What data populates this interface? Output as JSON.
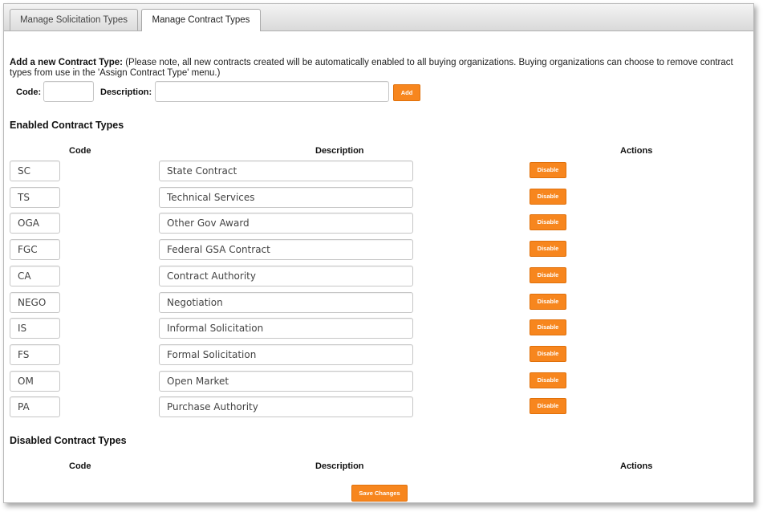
{
  "tabs": [
    {
      "label": "Manage Solicitation Types",
      "active": false
    },
    {
      "label": "Manage Contract Types",
      "active": true
    }
  ],
  "add_form": {
    "heading": "Add a new Contract Type:",
    "note": "(Please note, all new contracts created will be automatically enabled to all buying organizations. Buying organizations can choose to remove contract types from use in the 'Assign Contract Type' menu.)",
    "code_label": "Code:",
    "code_value": "",
    "description_label": "Description:",
    "description_value": "",
    "add_label": "Add"
  },
  "enabled": {
    "title": "Enabled Contract Types",
    "columns": {
      "code": "Code",
      "description": "Description",
      "actions": "Actions"
    },
    "action_label": "Disable",
    "rows": [
      {
        "code": "SC",
        "description": "State Contract"
      },
      {
        "code": "TS",
        "description": "Technical Services"
      },
      {
        "code": "OGA",
        "description": "Other Gov Award"
      },
      {
        "code": "FGC",
        "description": "Federal GSA Contract"
      },
      {
        "code": "CA",
        "description": "Contract Authority"
      },
      {
        "code": "NEGO",
        "description": "Negotiation"
      },
      {
        "code": "IS",
        "description": "Informal Solicitation"
      },
      {
        "code": "FS",
        "description": "Formal Solicitation"
      },
      {
        "code": "OM",
        "description": "Open Market"
      },
      {
        "code": "PA",
        "description": "Purchase Authority"
      }
    ]
  },
  "disabled": {
    "title": "Disabled Contract Types",
    "columns": {
      "code": "Code",
      "description": "Description",
      "actions": "Actions"
    },
    "rows": []
  },
  "save_label": "Save Changes",
  "colors": {
    "accent": "#f7861e",
    "accent_border": "#e0700a"
  }
}
